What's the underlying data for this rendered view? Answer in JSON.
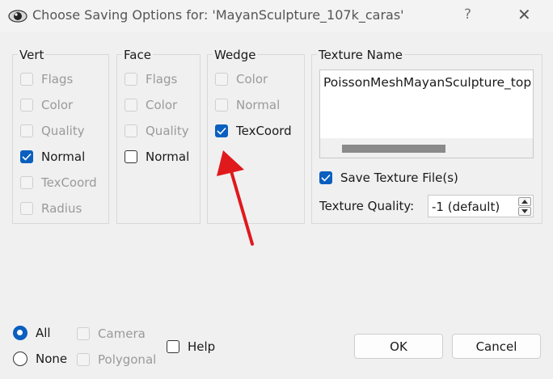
{
  "window": {
    "title": "Choose Saving Options for: 'MayanSculpture_107k_caras'",
    "help_glyph": "?",
    "close_glyph": "✕"
  },
  "vert": {
    "title": "Vert",
    "items": [
      {
        "label": "Flags",
        "checked": false,
        "enabled": false
      },
      {
        "label": "Color",
        "checked": false,
        "enabled": false
      },
      {
        "label": "Quality",
        "checked": false,
        "enabled": false
      },
      {
        "label": "Normal",
        "checked": true,
        "enabled": true
      },
      {
        "label": "TexCoord",
        "checked": false,
        "enabled": false
      },
      {
        "label": "Radius",
        "checked": false,
        "enabled": false
      }
    ]
  },
  "face": {
    "title": "Face",
    "items": [
      {
        "label": "Flags",
        "checked": false,
        "enabled": false
      },
      {
        "label": "Color",
        "checked": false,
        "enabled": false
      },
      {
        "label": "Quality",
        "checked": false,
        "enabled": false
      },
      {
        "label": "Normal",
        "checked": false,
        "enabled": true
      }
    ]
  },
  "wedge": {
    "title": "Wedge",
    "items": [
      {
        "label": "Color",
        "checked": false,
        "enabled": false
      },
      {
        "label": "Normal",
        "checked": false,
        "enabled": false
      },
      {
        "label": "TexCoord",
        "checked": true,
        "enabled": true
      }
    ]
  },
  "texture": {
    "title": "Texture Name",
    "name_value": "PoissonMeshMayanSculpture_top",
    "save_label": "Save Texture File(s)",
    "save_checked": true,
    "quality_label": "Texture Quality:",
    "quality_value": "-1 (default)"
  },
  "bottom": {
    "all_label": "All",
    "none_label": "None",
    "camera_label": "Camera",
    "polygonal_label": "Polygonal",
    "help_label": "Help",
    "ok_label": "OK",
    "cancel_label": "Cancel"
  },
  "colors": {
    "accent": "#0a5fbf",
    "annotation_arrow": "#e0191d"
  }
}
